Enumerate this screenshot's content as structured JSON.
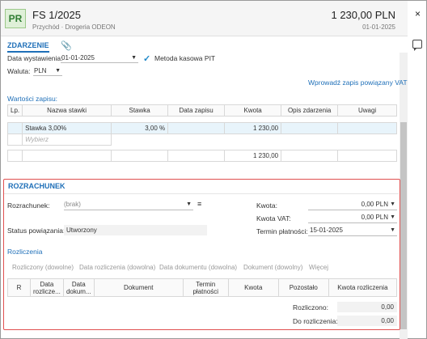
{
  "header": {
    "badge": "PR",
    "title": "FS 1/2025",
    "subtitle": "Przychód · Drogeria ODEON",
    "amount": "1 230,00 PLN",
    "date": "01-01-2025",
    "close": "×"
  },
  "tabs": {
    "active": "ZDARZENIE"
  },
  "form": {
    "issue_date_label": "Data wystawienia:",
    "issue_date_value": "01-01-2025",
    "cash_method_label": "Metoda kasowa PIT",
    "currency_label": "Waluta:",
    "currency_value": "PLN",
    "link_related": "Wprowadź zapis powiązany VAT"
  },
  "values": {
    "section_label": "Wartości zapisu:",
    "columns": [
      "Lp.",
      "Nazwa stawki",
      "Stawka",
      "Data zapisu",
      "Kwota",
      "Opis zdarzenia",
      "Uwagi"
    ],
    "row": {
      "name": "Stawka 3,00%",
      "rate": "3,00 %",
      "amount": "1 230,00"
    },
    "choose_placeholder": "Wybierz",
    "total": "1 230,00"
  },
  "rozrachunek": {
    "title": "ROZRACHUNEK",
    "rozrachunek_label": "Rozrachunek:",
    "rozrachunek_value": "(brak)",
    "status_label": "Status powiązania:",
    "status_value": "Utworzony",
    "kwota_label": "Kwota:",
    "kwota_value": "0,00 PLN",
    "kwota_vat_label": "Kwota VAT:",
    "kwota_vat_value": "0,00 PLN",
    "termin_label": "Termin płatności:",
    "termin_value": "15-01-2025",
    "rozliczenia_label": "Rozliczenia",
    "column_chips": [
      "Rozliczony (dowolne)",
      "Data rozliczenia (dowolna)",
      "Data dokumentu (dowolna)",
      "Dokument (dowolny)",
      "Więcej"
    ],
    "columns": [
      "R",
      "Data rozlicze...",
      "Data dokum...",
      "Dokument",
      "Termin płatności",
      "Kwota",
      "Pozostało",
      "Kwota rozliczenia"
    ],
    "rozliczono_label": "Rozliczono:",
    "rozliczono_value": "0,00",
    "do_rozliczenia_label": "Do rozliczenia:",
    "do_rozliczenia_value": "0,00"
  }
}
